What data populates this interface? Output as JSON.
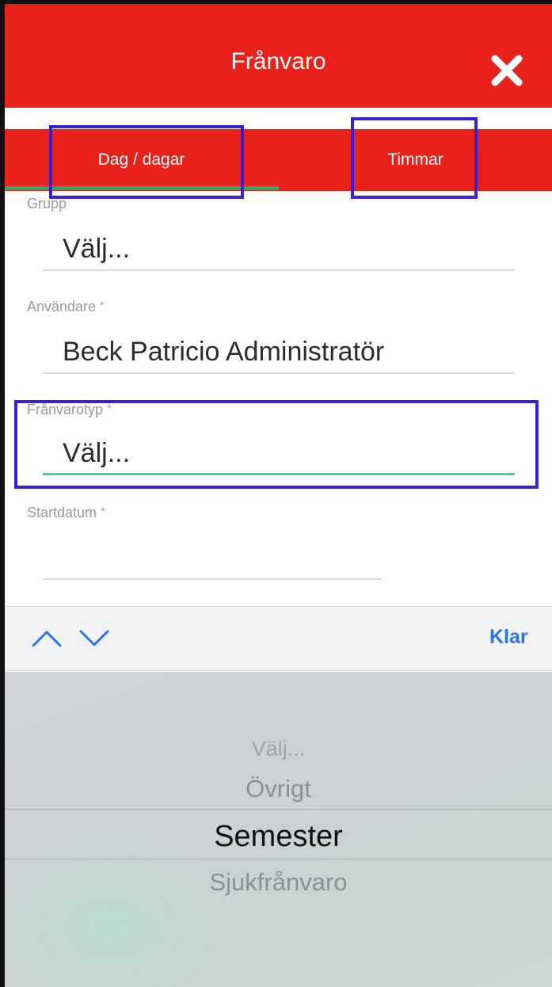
{
  "header": {
    "title": "Frånvaro",
    "close_icon": "close-icon"
  },
  "tabs": [
    {
      "label": "Dag / dagar",
      "active": true
    },
    {
      "label": "Timmar",
      "active": false
    }
  ],
  "form": {
    "grupp": {
      "label": "Grupp",
      "value": "Välj..."
    },
    "anvandare": {
      "label": "Användare",
      "required_mark": "*",
      "value": "Beck Patricio Administratör"
    },
    "franvarotyp": {
      "label": "Frånvarotyp",
      "required_mark": "*",
      "value": "Välj..."
    },
    "startdatum": {
      "label": "Startdatum",
      "required_mark": "*",
      "value": ""
    }
  },
  "toolbar": {
    "prev_icon": "chevron-up-icon",
    "next_icon": "chevron-down-icon",
    "done_label": "Klar"
  },
  "picker": {
    "options": [
      "Välj...",
      "Övrigt",
      "Semester",
      "Sjukfrånvaro"
    ],
    "selected": "Semester"
  },
  "colors": {
    "brand": "#e8221a",
    "accent_active": "#3ad88c",
    "tab_indicator": "#2fa86a",
    "link": "#2a73f0",
    "annotation": "#3a1fd6"
  }
}
